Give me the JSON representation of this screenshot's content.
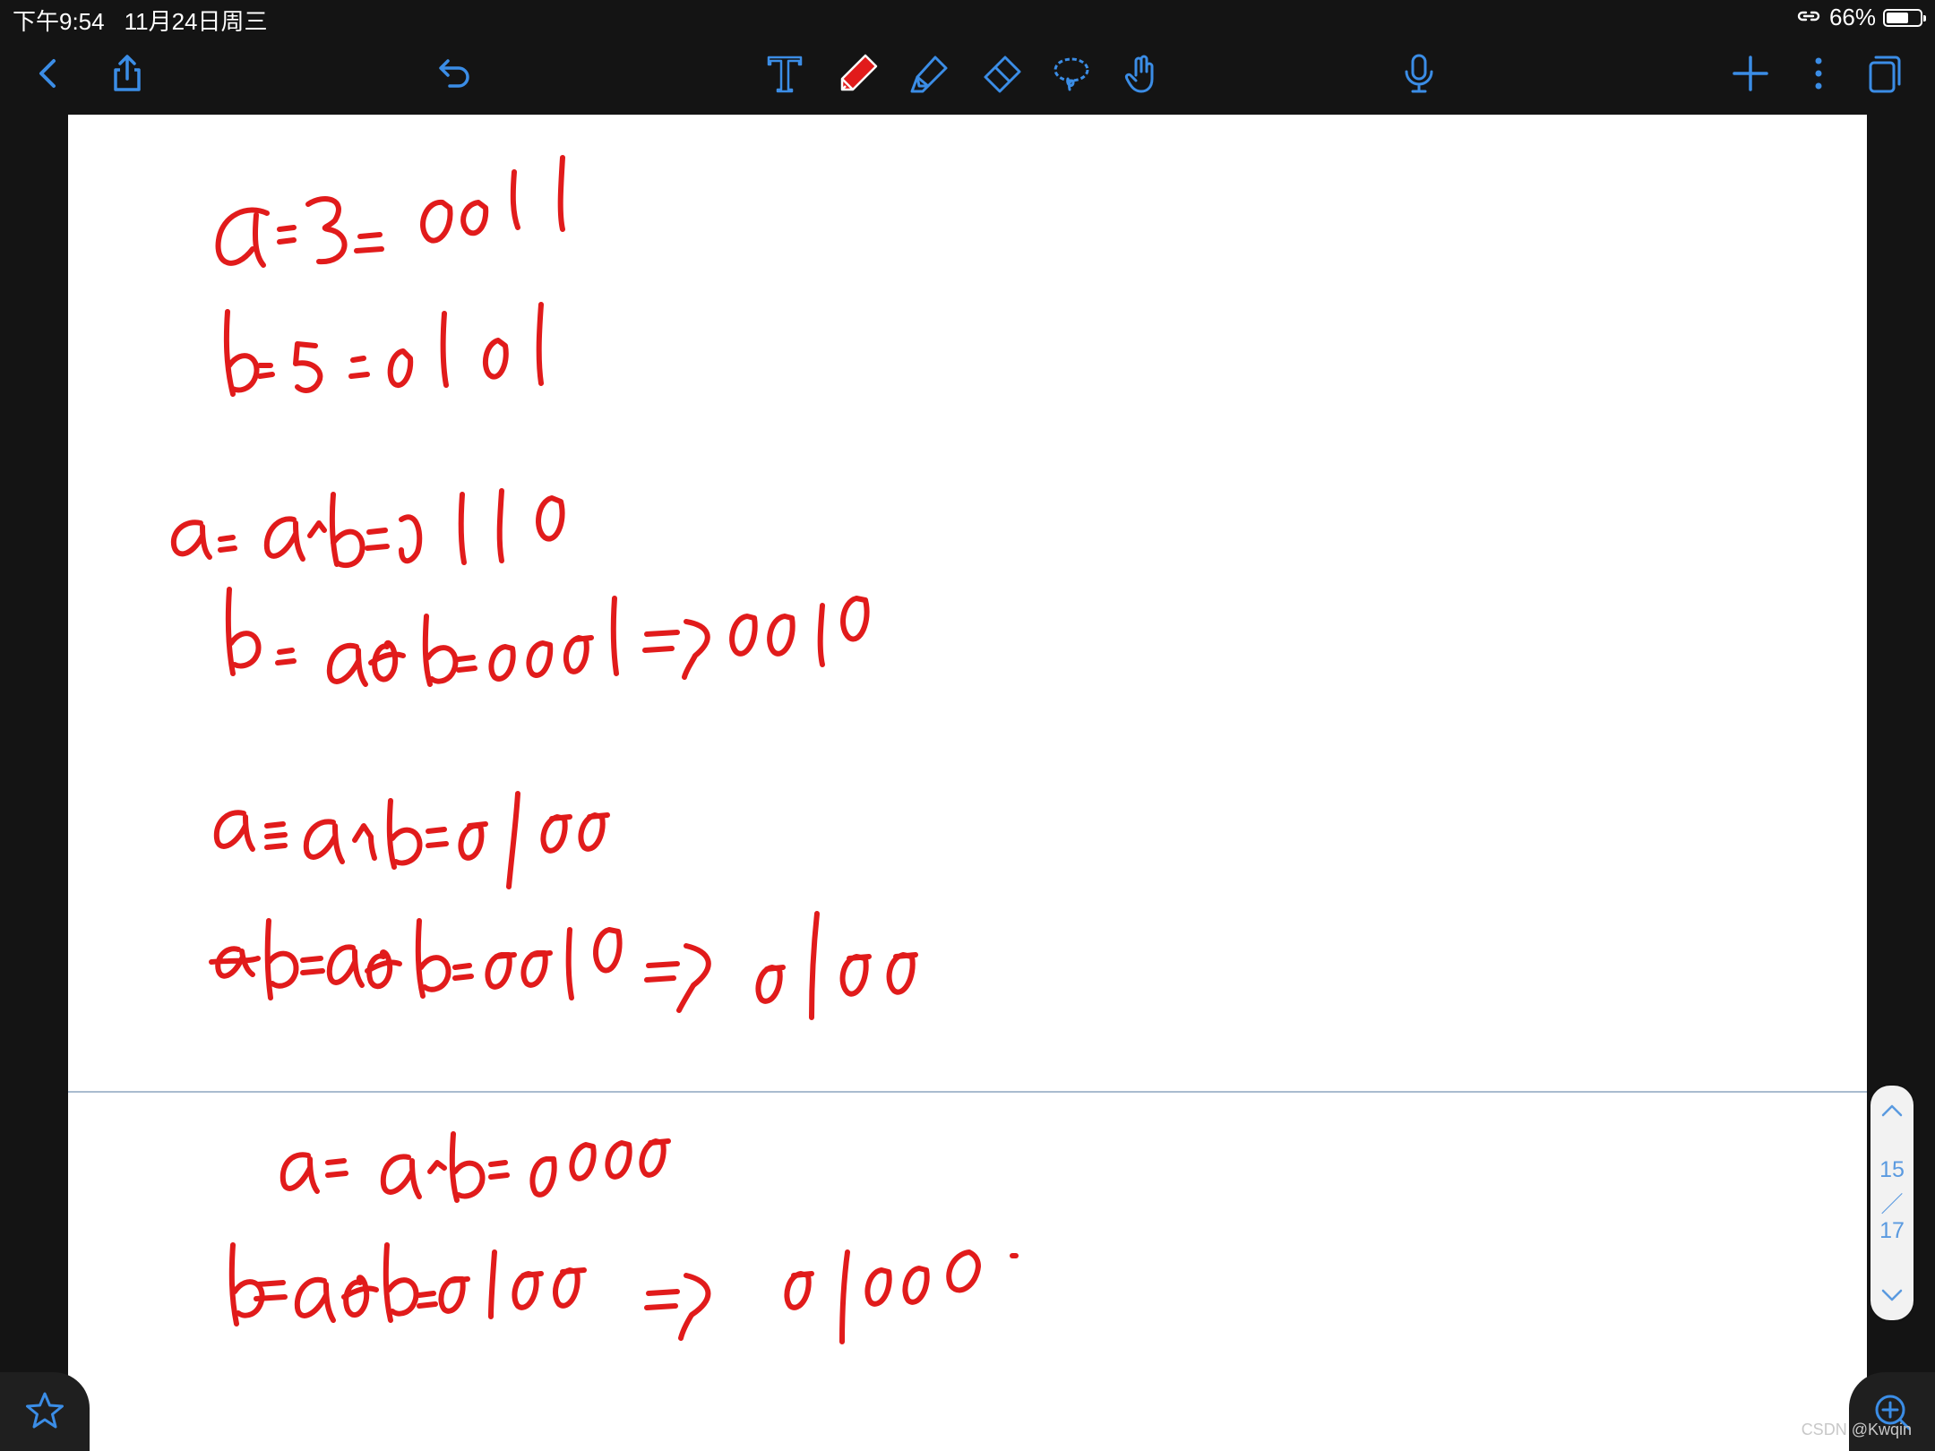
{
  "status_bar": {
    "time": "下午9:54",
    "date": "11月24日周三",
    "battery": "66%",
    "battery_level": 0.66
  },
  "toolbar": {
    "icons": [
      "back-icon",
      "share-icon",
      "undo-icon",
      "text-tool-icon",
      "pen-tool-icon",
      "highlighter-icon",
      "eraser-icon",
      "lasso-icon",
      "hand-tool-icon",
      "microphone-icon",
      "add-page-icon",
      "more-icon",
      "pages-icon"
    ],
    "accent_color": "#3b8de6",
    "pen_color": "#e11b1b"
  },
  "page_indicator": {
    "current": "15",
    "separator": "／",
    "total": "17"
  },
  "watermark": "CSDN @Kwqin"
}
